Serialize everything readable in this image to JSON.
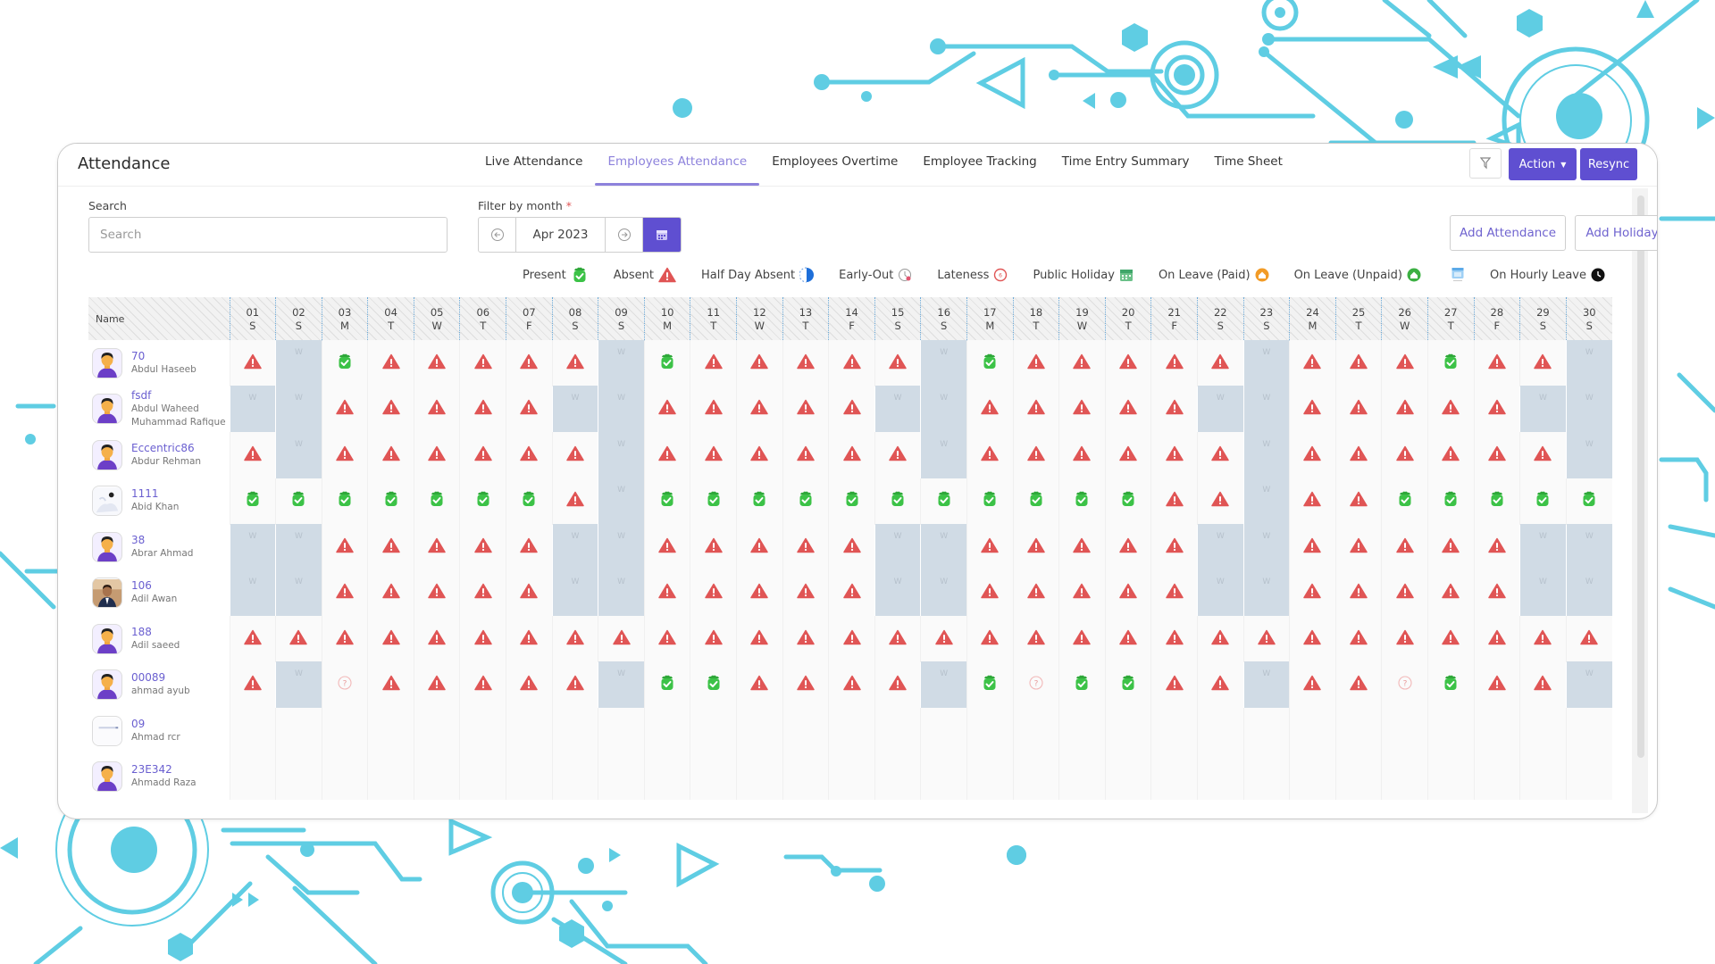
{
  "header": {
    "title": "Attendance",
    "tabs": [
      {
        "label": "Live Attendance",
        "active": false
      },
      {
        "label": "Employees Attendance",
        "active": true
      },
      {
        "label": "Employees Overtime",
        "active": false
      },
      {
        "label": "Employee Tracking",
        "active": false
      },
      {
        "label": "Time Entry Summary",
        "active": false
      },
      {
        "label": "Time Sheet",
        "active": false
      }
    ],
    "filter_icon": "filter-icon",
    "action_label": "Action",
    "resync_label": "Resync"
  },
  "filters": {
    "search_label": "Search",
    "search_placeholder": "Search",
    "search_value": "",
    "month_label": "Filter by month",
    "required_mark": "*",
    "month_value": "Apr 2023",
    "add_attendance_label": "Add Attendance",
    "add_holiday_label": "Add Holiday"
  },
  "legend": [
    {
      "label": "Present",
      "icon": "present"
    },
    {
      "label": "Absent",
      "icon": "absent"
    },
    {
      "label": "Half Day Absent",
      "icon": "halfday"
    },
    {
      "label": "Early-Out",
      "icon": "earlyout"
    },
    {
      "label": "Lateness",
      "icon": "lateness"
    },
    {
      "label": "Public Holiday",
      "icon": "holiday"
    },
    {
      "label": "On Leave (Paid)",
      "icon": "leavepaid"
    },
    {
      "label": "On Leave (Unpaid)",
      "icon": "leaveunpaid"
    },
    {
      "label": "",
      "icon": "halfcalendar"
    },
    {
      "label": "On Hourly Leave",
      "icon": "hourly"
    }
  ],
  "colors": {
    "accent": "#5f4fd1",
    "tab_active": "#8d82dc",
    "present": "#3cb043",
    "absent": "#e05555",
    "weekend": "#d0dbe5"
  },
  "grid": {
    "name_header": "Name",
    "weekend_mark": "W",
    "days": [
      {
        "d": "01",
        "w": "S"
      },
      {
        "d": "02",
        "w": "S"
      },
      {
        "d": "03",
        "w": "M"
      },
      {
        "d": "04",
        "w": "T"
      },
      {
        "d": "05",
        "w": "W"
      },
      {
        "d": "06",
        "w": "T"
      },
      {
        "d": "07",
        "w": "F"
      },
      {
        "d": "08",
        "w": "S"
      },
      {
        "d": "09",
        "w": "S"
      },
      {
        "d": "10",
        "w": "M"
      },
      {
        "d": "11",
        "w": "T"
      },
      {
        "d": "12",
        "w": "W"
      },
      {
        "d": "13",
        "w": "T"
      },
      {
        "d": "14",
        "w": "F"
      },
      {
        "d": "15",
        "w": "S"
      },
      {
        "d": "16",
        "w": "S"
      },
      {
        "d": "17",
        "w": "M"
      },
      {
        "d": "18",
        "w": "T"
      },
      {
        "d": "19",
        "w": "W"
      },
      {
        "d": "20",
        "w": "T"
      },
      {
        "d": "21",
        "w": "F"
      },
      {
        "d": "22",
        "w": "S"
      },
      {
        "d": "23",
        "w": "S"
      },
      {
        "d": "24",
        "w": "M"
      },
      {
        "d": "25",
        "w": "T"
      },
      {
        "d": "26",
        "w": "W"
      },
      {
        "d": "27",
        "w": "T"
      },
      {
        "d": "28",
        "w": "F"
      },
      {
        "d": "29",
        "w": "S"
      },
      {
        "d": "30",
        "w": "S"
      }
    ],
    "status_key": {
      "P": "present",
      "A": "absent",
      "W": "weekend",
      "Q": "unknown",
      "-": "empty"
    },
    "employees": [
      {
        "id": "70",
        "names": [
          "Abdul Haseeb"
        ],
        "avatar": "default",
        "status": [
          "A",
          "W",
          "P",
          "A",
          "A",
          "A",
          "A",
          "A",
          "W",
          "P",
          "A",
          "A",
          "A",
          "A",
          "A",
          "W",
          "P",
          "A",
          "A",
          "A",
          "A",
          "A",
          "W",
          "A",
          "A",
          "A",
          "P",
          "A",
          "A",
          "W"
        ]
      },
      {
        "id": "fsdf",
        "names": [
          "Abdul Waheed",
          "Muhammad Rafique"
        ],
        "avatar": "default",
        "status": [
          "W",
          "W",
          "A",
          "A",
          "A",
          "A",
          "A",
          "W",
          "W",
          "A",
          "A",
          "A",
          "A",
          "A",
          "W",
          "W",
          "A",
          "A",
          "A",
          "A",
          "A",
          "W",
          "W",
          "A",
          "A",
          "A",
          "A",
          "A",
          "W",
          "W"
        ]
      },
      {
        "id": "Eccentric86",
        "names": [
          "Abdur Rehman"
        ],
        "avatar": "default",
        "status": [
          "A",
          "W",
          "A",
          "A",
          "A",
          "A",
          "A",
          "A",
          "W",
          "A",
          "A",
          "A",
          "A",
          "A",
          "A",
          "W",
          "A",
          "A",
          "A",
          "A",
          "A",
          "A",
          "W",
          "A",
          "A",
          "A",
          "A",
          "A",
          "A",
          "W"
        ]
      },
      {
        "id": "1111",
        "names": [
          "Abid Khan"
        ],
        "avatar": "photo-light",
        "status": [
          "P",
          "P",
          "P",
          "P",
          "P",
          "P",
          "P",
          "A",
          "W",
          "P",
          "P",
          "P",
          "P",
          "P",
          "P",
          "P",
          "P",
          "P",
          "P",
          "P",
          "A",
          "A",
          "W",
          "A",
          "A",
          "P",
          "P",
          "P",
          "P",
          "P"
        ]
      },
      {
        "id": "38",
        "names": [
          "Abrar Ahmad"
        ],
        "avatar": "default",
        "status": [
          "W",
          "W",
          "A",
          "A",
          "A",
          "A",
          "A",
          "W",
          "W",
          "A",
          "A",
          "A",
          "A",
          "A",
          "W",
          "W",
          "A",
          "A",
          "A",
          "A",
          "A",
          "W",
          "W",
          "A",
          "A",
          "A",
          "A",
          "A",
          "W",
          "W"
        ]
      },
      {
        "id": "106",
        "names": [
          "Adil Awan"
        ],
        "avatar": "photo",
        "status": [
          "W",
          "W",
          "A",
          "A",
          "A",
          "A",
          "A",
          "W",
          "W",
          "A",
          "A",
          "A",
          "A",
          "A",
          "W",
          "W",
          "A",
          "A",
          "A",
          "A",
          "A",
          "W",
          "W",
          "A",
          "A",
          "A",
          "A",
          "A",
          "W",
          "W"
        ]
      },
      {
        "id": "188",
        "names": [
          "Adil saeed"
        ],
        "avatar": "default",
        "status": [
          "A",
          "A",
          "A",
          "A",
          "A",
          "A",
          "A",
          "A",
          "A",
          "A",
          "A",
          "A",
          "A",
          "A",
          "A",
          "A",
          "A",
          "A",
          "A",
          "A",
          "A",
          "A",
          "A",
          "A",
          "A",
          "A",
          "A",
          "A",
          "A",
          "A"
        ]
      },
      {
        "id": "00089",
        "names": [
          "ahmad ayub"
        ],
        "avatar": "default",
        "status": [
          "A",
          "W",
          "Q",
          "A",
          "A",
          "A",
          "A",
          "A",
          "W",
          "P",
          "P",
          "A",
          "A",
          "A",
          "A",
          "W",
          "P",
          "Q",
          "P",
          "P",
          "A",
          "A",
          "W",
          "A",
          "A",
          "Q",
          "P",
          "A",
          "A",
          "W"
        ]
      },
      {
        "id": "09",
        "names": [
          "Ahmad rcr"
        ],
        "avatar": "blank",
        "status": [
          "-",
          "-",
          "-",
          "-",
          "-",
          "-",
          "-",
          "-",
          "-",
          "-",
          "-",
          "-",
          "-",
          "-",
          "-",
          "-",
          "-",
          "-",
          "-",
          "-",
          "-",
          "-",
          "-",
          "-",
          "-",
          "-",
          "-",
          "-",
          "-",
          "-"
        ]
      },
      {
        "id": "23E342",
        "names": [
          "Ahmadd Raza"
        ],
        "avatar": "default",
        "status": [
          "-",
          "-",
          "-",
          "-",
          "-",
          "-",
          "-",
          "-",
          "-",
          "-",
          "-",
          "-",
          "-",
          "-",
          "-",
          "-",
          "-",
          "-",
          "-",
          "-",
          "-",
          "-",
          "-",
          "-",
          "-",
          "-",
          "-",
          "-",
          "-",
          "-"
        ]
      }
    ]
  }
}
